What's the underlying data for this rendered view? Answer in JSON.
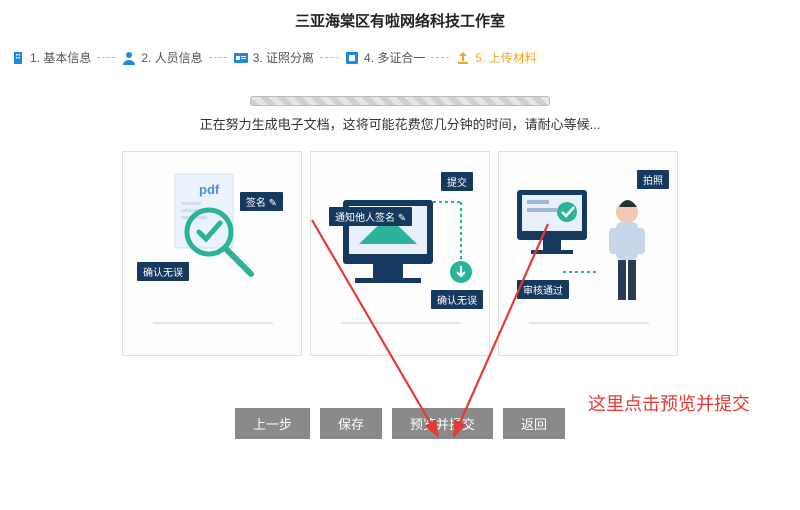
{
  "title": "三亚海棠区有啦网络科技工作室",
  "steps": [
    {
      "label": "1. 基本信息"
    },
    {
      "label": "2. 人员信息"
    },
    {
      "label": "3. 证照分离"
    },
    {
      "label": "4. 多证合一"
    },
    {
      "label": "5. 上传材料"
    }
  ],
  "status_text": "正在努力生成电子文档，这将可能花费您几分钟的时间，请耐心等候...",
  "cards": [
    {
      "pdf_label": "pdf",
      "tag_confirm": "确认无误",
      "tag_sign": "签名 ✎"
    },
    {
      "tag_submit": "提交",
      "tag_notify": "通知他人签名 ✎",
      "tag_confirm": "确认无误"
    },
    {
      "tag_camera": "拍照",
      "tag_approved": "审核通过"
    }
  ],
  "annotation": "这里点击预览并提交",
  "buttons": {
    "prev": "上一步",
    "save": "保存",
    "preview_submit": "预览并提交",
    "back": "返回"
  }
}
